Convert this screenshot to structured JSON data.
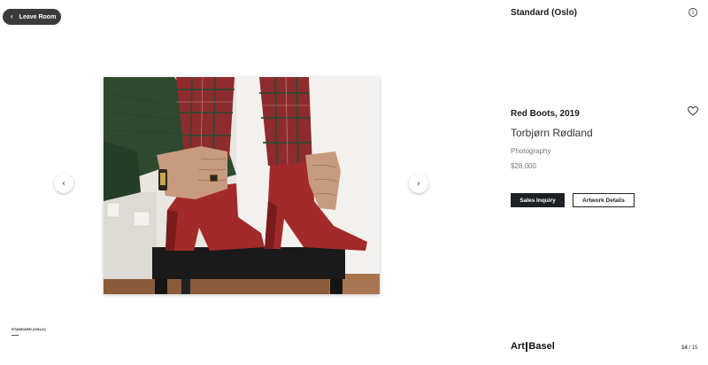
{
  "header": {
    "leave_label": "Leave Room",
    "gallery_name": "Standard (Oslo)"
  },
  "artwork": {
    "title": "Red Boots, 2019",
    "artist": "Torbjørn Rødland",
    "medium": "Photography",
    "price": "$28,000"
  },
  "actions": {
    "inquiry_label": "Sales Inquiry",
    "details_label": "Artwork Details"
  },
  "footer": {
    "gallery_small": "STANDARD (OSLO)",
    "logo_left": "Art",
    "logo_right": "Basel",
    "page_current": "14",
    "page_separator": " / ",
    "page_total": "15"
  },
  "icons": {
    "back": "chevron-left-icon",
    "info": "info-icon",
    "favorite": "heart-icon",
    "prev": "chevron-left-icon",
    "next": "chevron-right-icon"
  },
  "colors": {
    "primary_button": "#1c1f24",
    "boot_red": "#a32a2a"
  }
}
